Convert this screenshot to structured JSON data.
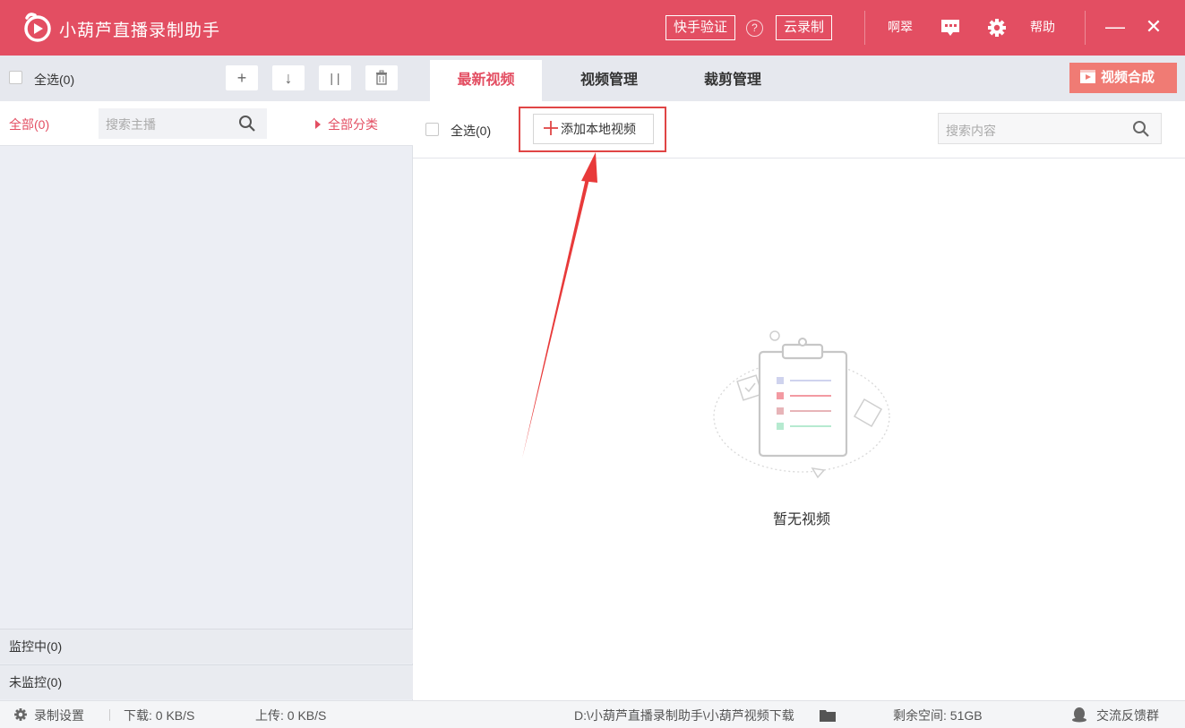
{
  "app": {
    "title": "小葫芦直播录制助手",
    "kuaishou_verify": "快手验证",
    "help_circle": "?",
    "cloud_record": "云录制",
    "username": "啊翠",
    "help": "帮助",
    "minimize": "—",
    "close": "✕"
  },
  "left": {
    "select_all": "全选(0)",
    "toolbar": {
      "add": "+",
      "download": "↓",
      "pause": "| |"
    },
    "filter_all": "全部(0)",
    "search_placeholder": "搜索主播",
    "all_categories": "全部分类",
    "monitoring": "监控中(0)",
    "not_monitoring": "未监控(0)"
  },
  "tabs": [
    "最新视频",
    "视频管理",
    "裁剪管理"
  ],
  "merge_button": "视频合成",
  "content": {
    "select_all": "全选(0)",
    "add_local_video": "添加本地视频",
    "search_placeholder": "搜索内容",
    "empty_text": "暂无视频"
  },
  "statusbar": {
    "record_settings": "录制设置",
    "download": "下载: 0 KB/S",
    "upload": "上传: 0 KB/S",
    "path": "D:\\小葫芦直播录制助手\\小葫芦视频下载",
    "free_space": "剩余空间: 51GB",
    "feedback": "交流反馈群"
  },
  "colors": {
    "brand": "#e34e62",
    "merge": "#f07b74",
    "highlight": "#e04545"
  }
}
